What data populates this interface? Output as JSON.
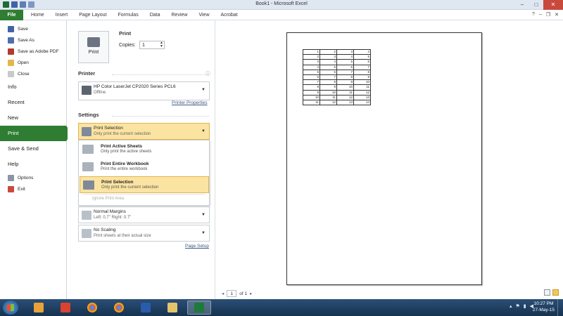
{
  "window": {
    "title": "Book1 - Microsoft Excel"
  },
  "ribbon": {
    "file_tab": "File",
    "tabs": [
      "Home",
      "Insert",
      "Page Layout",
      "Formulas",
      "Data",
      "Review",
      "View",
      "Acrobat"
    ]
  },
  "nav": {
    "save": "Save",
    "save_as": "Save As",
    "save_pdf": "Save as Adobe PDF",
    "open": "Open",
    "close": "Close",
    "info": "Info",
    "recent": "Recent",
    "new": "New",
    "print": "Print",
    "save_send": "Save & Send",
    "help": "Help",
    "options": "Options",
    "exit": "Exit"
  },
  "print": {
    "heading": "Print",
    "button_label": "Print",
    "copies_label": "Copies:",
    "copies_value": "1"
  },
  "printer": {
    "section_title": "Printer",
    "name": "HP Color LaserJet CP2020 Series PCL6",
    "status": "Offline",
    "properties_link": "Printer Properties"
  },
  "settings": {
    "section_title": "Settings",
    "what_to_print": {
      "title": "Print Selection",
      "subtitle": "Only print the current selection"
    },
    "menu": {
      "items": [
        {
          "title": "Print Active Sheets",
          "subtitle": "Only print the active sheets"
        },
        {
          "title": "Print Entire Workbook",
          "subtitle": "Print the entire workbook"
        },
        {
          "title": "Print Selection",
          "subtitle": "Only print the current selection"
        }
      ],
      "ignore_print_area": "Ignore Print Area"
    },
    "margins": {
      "title": "Normal Margins",
      "subtitle": "Left: 0.7\"    Right: 0.7\""
    },
    "scaling": {
      "title": "No Scaling",
      "subtitle": "Print sheets at their actual size"
    },
    "page_setup_link": "Page Setup"
  },
  "preview": {
    "rows": [
      [
        "1",
        "2",
        "3",
        "4"
      ],
      [
        "2",
        "3",
        "4",
        "5"
      ],
      [
        "3",
        "4",
        "5",
        "6"
      ],
      [
        "4",
        "5",
        "6",
        "7"
      ],
      [
        "5",
        "6",
        "7",
        "8"
      ],
      [
        "6",
        "7",
        "8",
        "9"
      ],
      [
        "7",
        "8",
        "9",
        "10"
      ],
      [
        "8",
        "9",
        "10",
        "11"
      ],
      [
        "9",
        "10",
        "11",
        "12"
      ],
      [
        "10",
        "11",
        "12",
        "13"
      ],
      [
        "11",
        "12",
        "13",
        "14"
      ]
    ],
    "page_current": "1",
    "page_of": "of 1"
  },
  "taskbar": {
    "time": "10:27 PM",
    "date": "27-May-15"
  },
  "colors": {
    "file_green": "#2e7d32",
    "highlight": "#fbe3a2",
    "taskbar": "#1f4266"
  }
}
